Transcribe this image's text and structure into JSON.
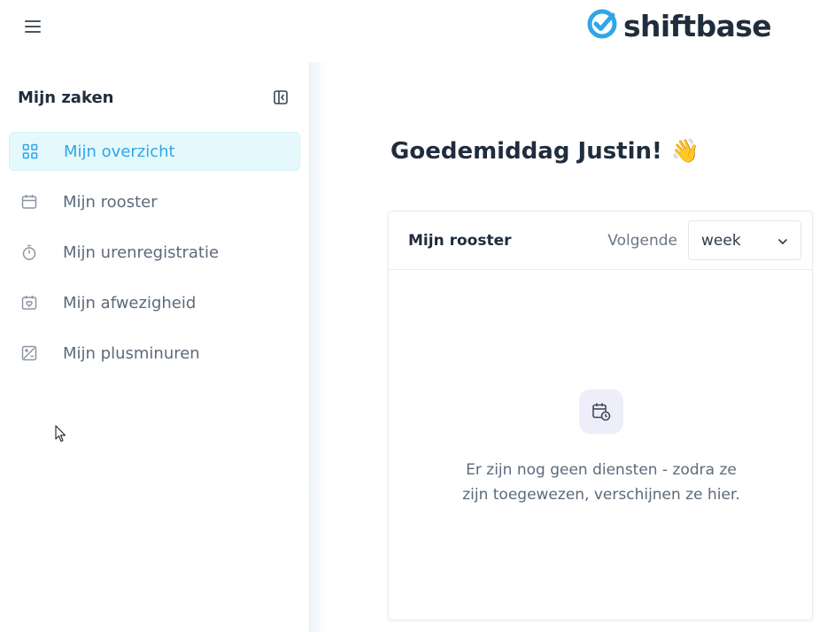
{
  "brand": {
    "name": "shiftbase",
    "accent": "#2fa6e9"
  },
  "sidebar": {
    "title": "Mijn zaken",
    "items": [
      {
        "label": "Mijn overzicht",
        "icon": "grid-icon",
        "active": true
      },
      {
        "label": "Mijn rooster",
        "icon": "calendar-icon",
        "active": false
      },
      {
        "label": "Mijn urenregistratie",
        "icon": "stopwatch-icon",
        "active": false
      },
      {
        "label": "Mijn afwezigheid",
        "icon": "calendar-heart-icon",
        "active": false
      },
      {
        "label": "Mijn plusminuren",
        "icon": "plus-minus-icon",
        "active": false
      }
    ]
  },
  "main": {
    "greeting": "Goedemiddag Justin!",
    "greeting_emoji": "👋",
    "card": {
      "title": "Mijn rooster",
      "range_label": "Volgende",
      "range_value": "week",
      "empty_line_1": "Er zijn nog geen diensten - zodra ze",
      "empty_line_2": "zijn toegewezen, verschijnen ze hier."
    }
  }
}
